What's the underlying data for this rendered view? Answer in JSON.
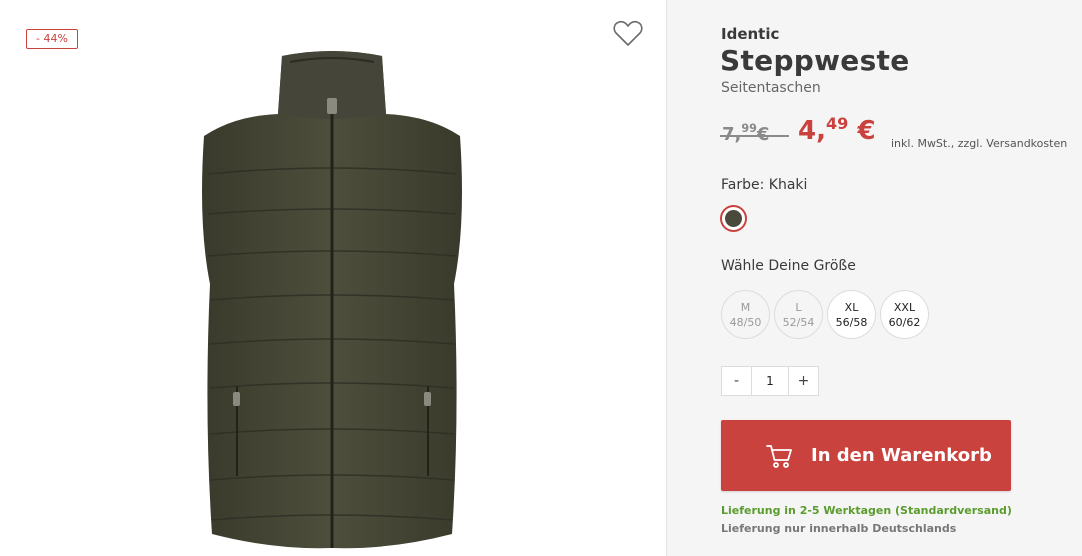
{
  "badge": {
    "discount": "- 44%"
  },
  "icons": {
    "wishlist": "heart-outline-icon",
    "cart": "shopping-cart-icon"
  },
  "product": {
    "brand": "Identic",
    "title": "Steppweste",
    "subtitle": "Seitentaschen",
    "old_price_main": "7,",
    "old_price_cents": "99",
    "old_price_currency": "€",
    "new_price_main": "4,",
    "new_price_cents": "49",
    "new_price_currency": "€",
    "tax_note": "inkl. MwSt., zzgl. Versandkosten"
  },
  "color": {
    "label": "Farbe: Khaki",
    "swatch": "#4a4a3c",
    "accent": "#c9423e"
  },
  "sizes": {
    "label": "Wähle Deine Größe",
    "options": [
      {
        "name": "M",
        "value": "48/50",
        "available": false
      },
      {
        "name": "L",
        "value": "52/54",
        "available": false
      },
      {
        "name": "XL",
        "value": "56/58",
        "available": true
      },
      {
        "name": "XXL",
        "value": "60/62",
        "available": true
      }
    ]
  },
  "quantity": {
    "minus": "-",
    "value": "1",
    "plus": "+"
  },
  "cart": {
    "label": "In den Warenkorb",
    "color": "#c9423e"
  },
  "delivery": {
    "time": "Lieferung in 2-5 Werktagen (Standardversand)",
    "note": "Lieferung nur innerhalb Deutschlands"
  }
}
